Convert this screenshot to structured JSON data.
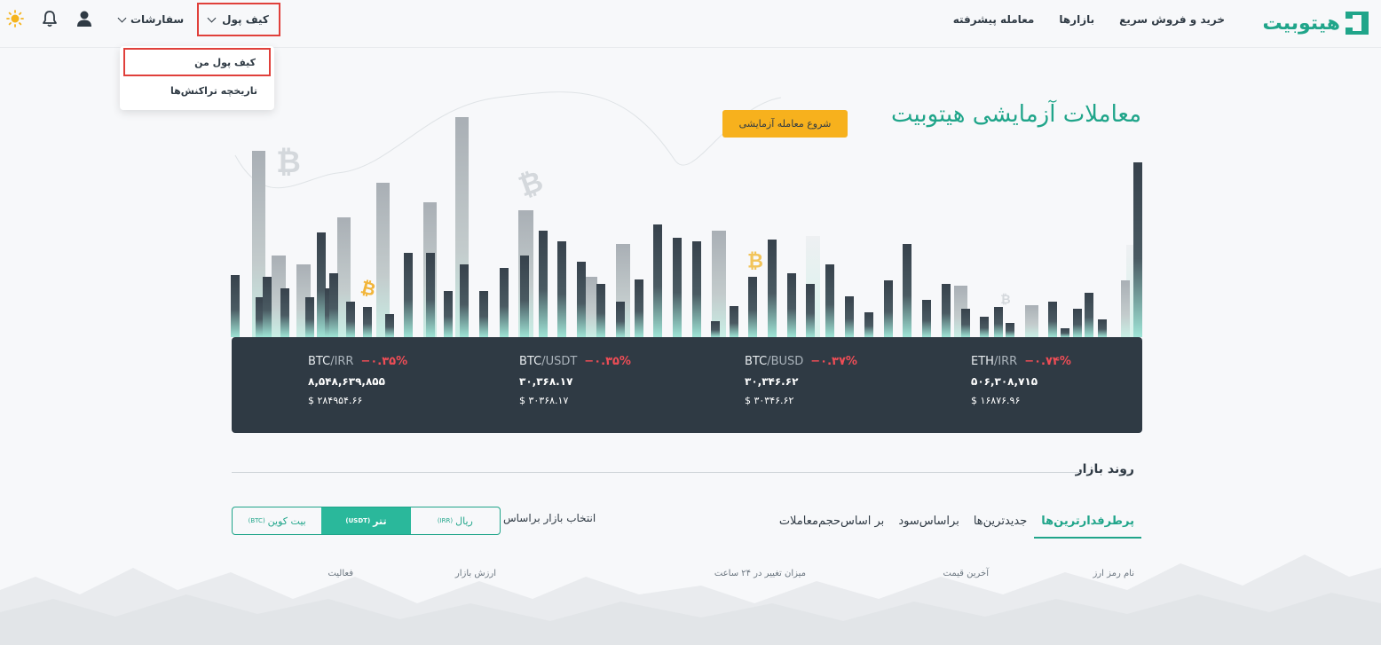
{
  "header": {
    "logo_text": "هیتوبیت",
    "nav": [
      "خرید و فروش سریع",
      "بازارها",
      "معامله پیشرفته"
    ],
    "orders_label": "سفارشات",
    "wallet_label": "کیف پول",
    "icons": [
      "sun-icon",
      "bell-icon",
      "user-icon"
    ]
  },
  "wallet_menu": {
    "items": [
      "کیف پول من",
      "تاریخچه تراکنش‌ها"
    ]
  },
  "hero": {
    "title": "معاملات آزمایشی هیتوبیت",
    "demo_button": "شروع معامله آزمایشی"
  },
  "tickers": [
    {
      "base": "BTC",
      "quote": "/IRR",
      "change": "−۰.۳۵%",
      "price": "۸,۵۴۸,۶۳۹,۸۵۵",
      "usd": "$ ۲۸۴۹۵۴.۶۶"
    },
    {
      "base": "BTC",
      "quote": "/USDT",
      "change": "−۰.۳۵%",
      "price": "۳۰,۳۶۸.۱۷",
      "usd": "$ ۳۰۳۶۸.۱۷"
    },
    {
      "base": "BTC",
      "quote": "/BUSD",
      "change": "−۰.۳۷%",
      "price": "۳۰,۳۴۶.۶۲",
      "usd": "$ ۳۰۳۴۶.۶۲"
    },
    {
      "base": "ETH",
      "quote": "/IRR",
      "change": "−۰.۷۴%",
      "price": "۵۰۶,۳۰۸,۷۱۵",
      "usd": "$ ۱۶۸۷۶.۹۶"
    }
  ],
  "market": {
    "title": "روند بازار",
    "tabs": [
      "پرطرفدارترین‌ها",
      "جدیدترین‌ها",
      "براساس‌سود",
      "بر اساس‌حجم‌معاملات"
    ],
    "select_label": "انتخاب بازار براساس",
    "segments": [
      {
        "label": "ریال",
        "code": "(IRR)"
      },
      {
        "label": "تتر",
        "code": "(USDT)"
      },
      {
        "label": "بیت کوین",
        "code": "(BTC)"
      }
    ],
    "active_segment": 1,
    "columns": [
      "نام رمز ارز",
      "آخرین قیمت",
      "میزان تغییر در ۲۴ ساعت",
      "ارزش بازار",
      "فعالیت"
    ]
  },
  "colors": {
    "brand": "#20a58a",
    "accent": "#f7b11d",
    "panel": "#2f3a44",
    "negative": "#ef4d56",
    "highlight": "#e0403b"
  }
}
